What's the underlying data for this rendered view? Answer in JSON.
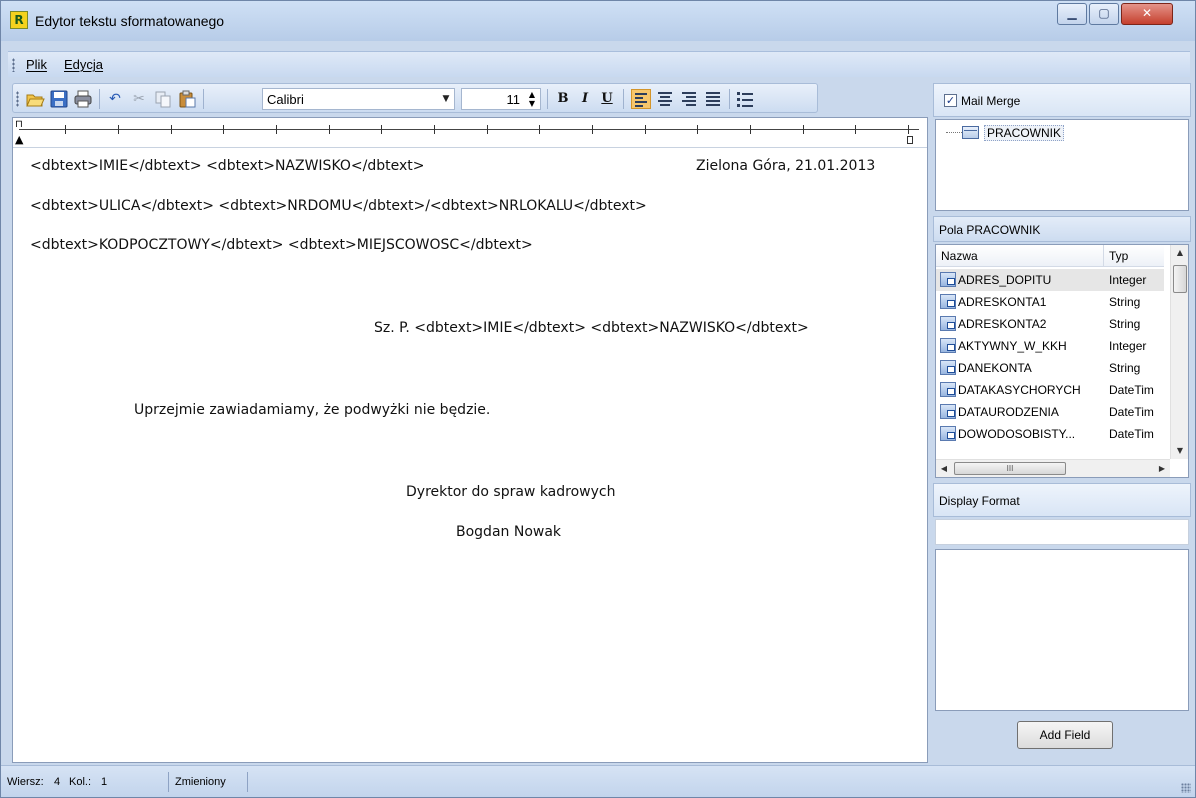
{
  "window": {
    "title": "Edytor tekstu sformatowanego",
    "app_icon_letter": "R"
  },
  "menu": {
    "items": [
      "Plik",
      "Edycja"
    ]
  },
  "toolbar": {
    "font": "Calibri",
    "font_size": "11",
    "bold": "B",
    "italic": "I",
    "underline": "U",
    "icons": [
      "open-folder-icon",
      "save-disk-icon",
      "print-icon",
      "undo-icon",
      "cut-icon",
      "copy-icon",
      "paste-icon",
      "align-left-icon",
      "align-center-icon",
      "align-right-icon",
      "align-justify-icon",
      "bullet-list-icon"
    ],
    "active_alignment": "left"
  },
  "document": {
    "line1": "<dbtext>IMIE</dbtext> <dbtext>NAZWISKO</dbtext>",
    "date": "Zielona Góra, 21.01.2013",
    "line2": "<dbtext>ULICA</dbtext> <dbtext>NRDOMU</dbtext>/<dbtext>NRLOKALU</dbtext>",
    "line3": "<dbtext>KODPOCZTOWY</dbtext> <dbtext>MIEJSCOWOSC</dbtext>",
    "salutation": "Sz. P. <dbtext>IMIE</dbtext> <dbtext>NAZWISKO</dbtext>",
    "body": "Uprzejmie zawiadamiamy, że podwyżki nie będzie.",
    "signature_title": "Dyrektor do spraw kadrowych",
    "signature_name": "Bogdan Nowak"
  },
  "mail_merge": {
    "label": "Mail Merge",
    "checked": true,
    "tree_node": "PRACOWNIK"
  },
  "fields_panel": {
    "title": "Pola PRACOWNIK",
    "col_name": "Nazwa",
    "col_type": "Typ",
    "rows": [
      {
        "name": "ADRES_DOPITU",
        "type": "Integer"
      },
      {
        "name": "ADRESKONTA1",
        "type": "String"
      },
      {
        "name": "ADRESKONTA2",
        "type": "String"
      },
      {
        "name": "AKTYWNY_W_KKH",
        "type": "Integer"
      },
      {
        "name": "DANEKONTA",
        "type": "String"
      },
      {
        "name": "DATAKASYCHORYCH",
        "type": "DateTim"
      },
      {
        "name": "DATAURODZENIA",
        "type": "DateTim"
      },
      {
        "name": "DOWODOSOBISTY...",
        "type": "DateTim"
      }
    ],
    "hscroll_thumb": "III"
  },
  "display_format": {
    "label": "Display Format",
    "value": ""
  },
  "add_field_button": "Add Field",
  "status": {
    "row_label": "Wiersz:",
    "row_value": "4",
    "col_label": "Kol.:",
    "col_value": "1",
    "state": "Zmieniony"
  },
  "colors": {
    "window_bg": "#c9d8ec",
    "active_align_bg": "#f6c66c",
    "close_button": "#c5402e"
  }
}
